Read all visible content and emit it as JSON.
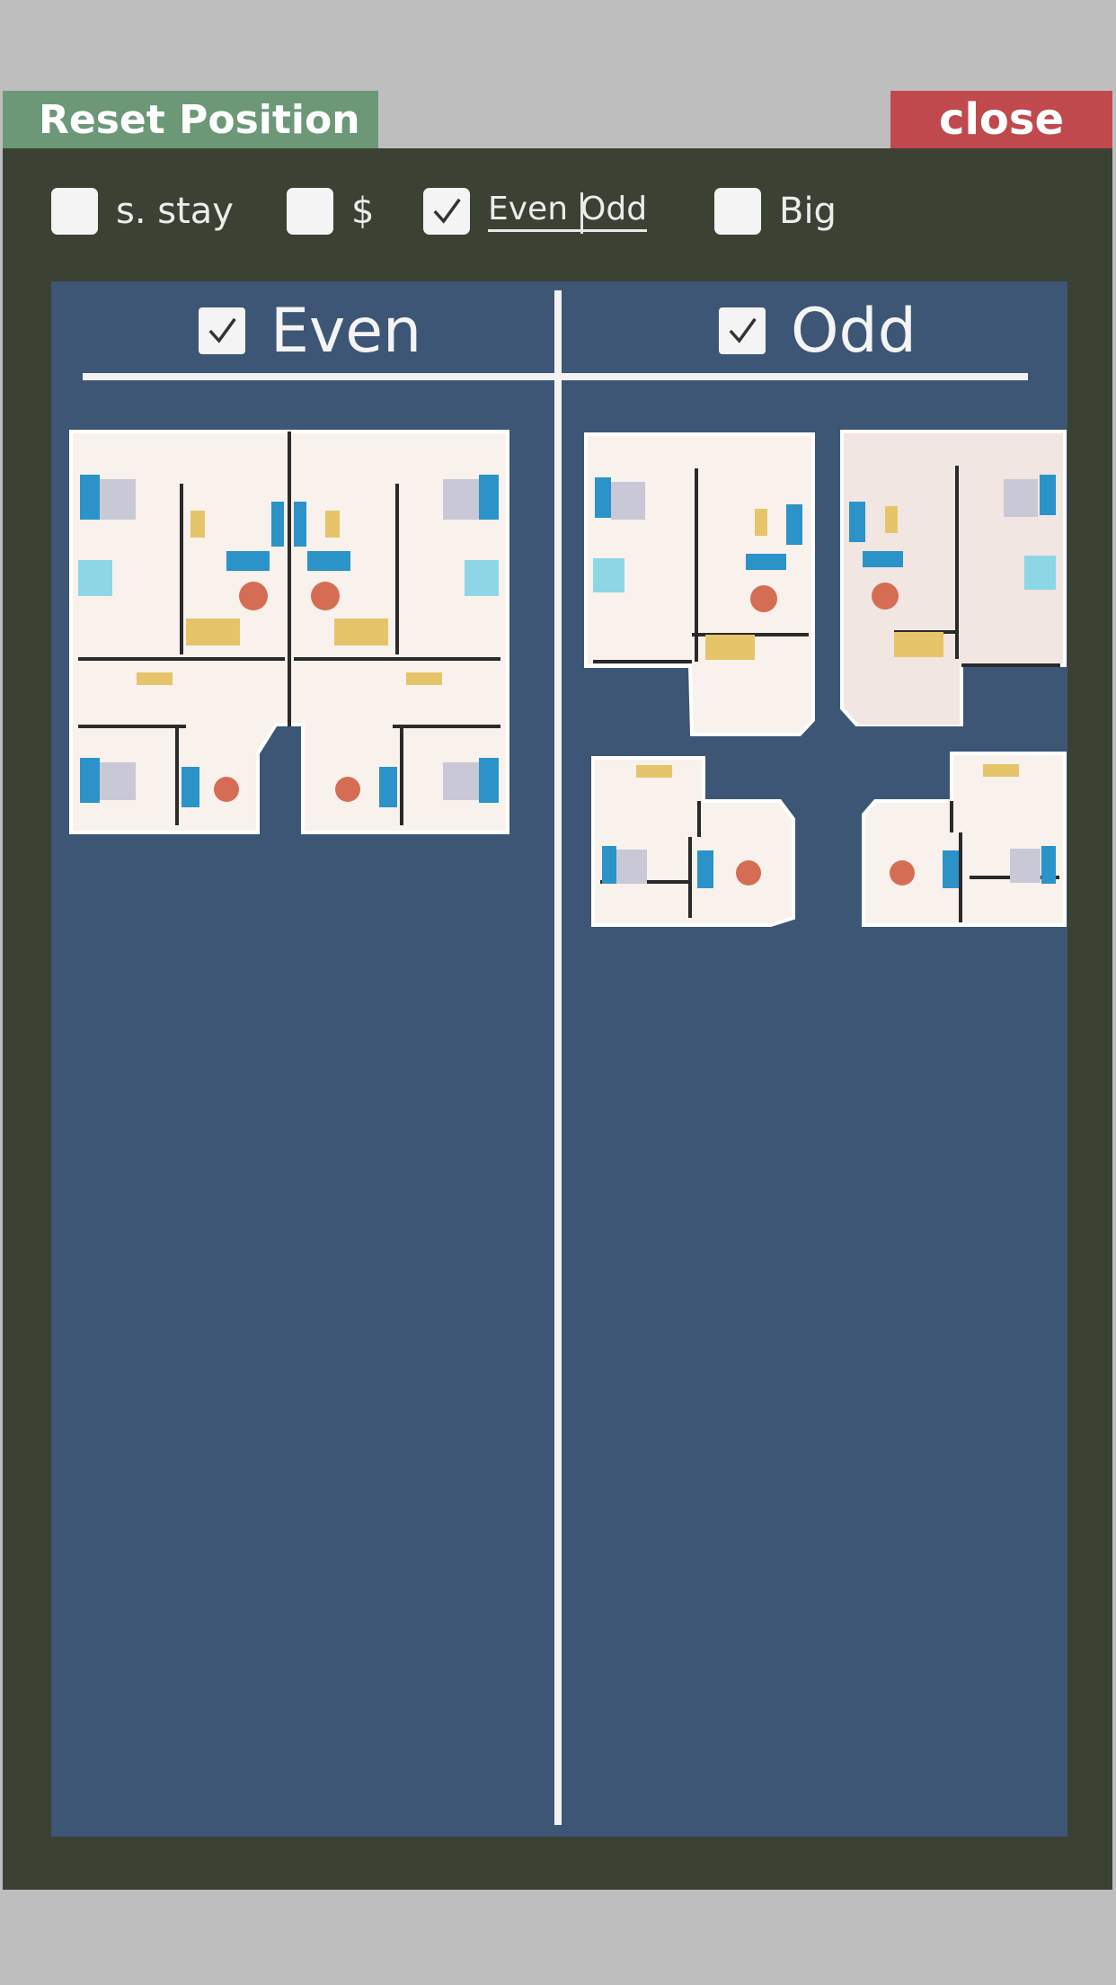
{
  "toolbar": {
    "reset_label": "Reset Position",
    "close_label": "close"
  },
  "filters": [
    {
      "label": "s. stay",
      "checked": false
    },
    {
      "label": "$",
      "checked": false
    },
    {
      "label_left": "Even",
      "label_right": "Odd",
      "checked": true
    },
    {
      "label": "Big",
      "checked": false
    }
  ],
  "columns": {
    "even": {
      "label": "Even",
      "checked": true
    },
    "odd": {
      "label": "Odd",
      "checked": true
    }
  },
  "colors": {
    "background": "#bebebe",
    "panel": "#3b4234",
    "board": "#3e5675",
    "reset_button": "#6c9878",
    "close_button": "#c0494d"
  },
  "icons": [
    "checkmark-icon",
    "floor-plan-icon"
  ]
}
